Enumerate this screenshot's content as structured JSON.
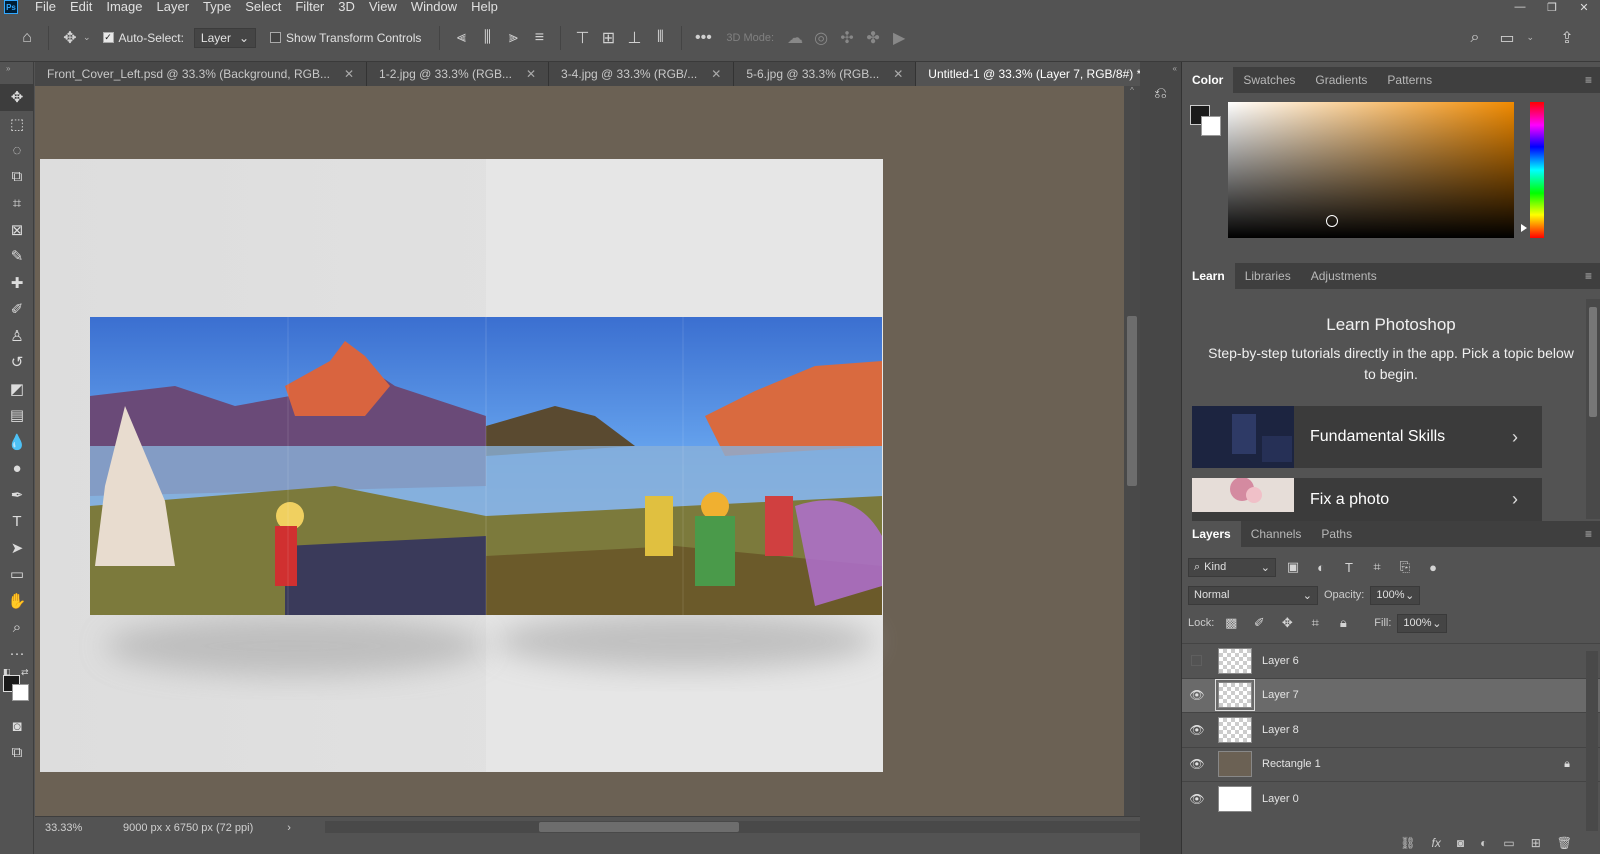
{
  "menubar": {
    "logo": "Ps",
    "items": [
      "File",
      "Edit",
      "Image",
      "Layer",
      "Type",
      "Select",
      "Filter",
      "3D",
      "View",
      "Window",
      "Help"
    ],
    "window_controls": [
      "—",
      "❐",
      "✕"
    ]
  },
  "options_bar": {
    "auto_select_label": "Auto-Select:",
    "auto_select_value": "Layer",
    "show_transform_label": "Show Transform Controls",
    "mode_3d_label": "3D Mode:"
  },
  "tabs": [
    {
      "label": "Front_Cover_Left.psd @ 33.3% (Background, RGB...",
      "active": false
    },
    {
      "label": "1-2.jpg @ 33.3% (RGB...",
      "active": false
    },
    {
      "label": "3-4.jpg @ 33.3% (RGB/...",
      "active": false
    },
    {
      "label": "5-6.jpg @ 33.3% (RGB...",
      "active": false
    },
    {
      "label": "Untitled-1 @ 33.3% (Layer 7, RGB/8#) *",
      "active": true
    }
  ],
  "status": {
    "zoom": "33.33%",
    "doc_info": "9000 px x 6750 px (72 ppi)"
  },
  "color_panel": {
    "tabs": [
      "Color",
      "Swatches",
      "Gradients",
      "Patterns"
    ],
    "colors": {
      "foreground": "#1a1a1a",
      "background": "#ffffff",
      "hue": "#f08a00"
    }
  },
  "learn_panel": {
    "tabs": [
      "Learn",
      "Libraries",
      "Adjustments"
    ],
    "title": "Learn Photoshop",
    "subtitle": "Step-by-step tutorials directly in the app. Pick a topic below to begin.",
    "cards": [
      {
        "label": "Fundamental Skills"
      },
      {
        "label": "Fix a photo"
      }
    ]
  },
  "layers_panel": {
    "tabs": [
      "Layers",
      "Channels",
      "Paths"
    ],
    "filter_kind": "Kind",
    "blend_mode": "Normal",
    "opacity_label": "Opacity:",
    "opacity_value": "100%",
    "lock_label": "Lock:",
    "fill_label": "Fill:",
    "fill_value": "100%",
    "layers": [
      {
        "name": "Layer 6",
        "visible": false,
        "selected": false
      },
      {
        "name": "Layer 7",
        "visible": true,
        "selected": true
      },
      {
        "name": "Layer 8",
        "visible": true,
        "selected": false
      },
      {
        "name": "Rectangle 1",
        "visible": true,
        "selected": false,
        "locked": true
      },
      {
        "name": "Layer 0",
        "visible": true,
        "selected": false
      }
    ],
    "footer_icons": [
      "link-icon",
      "fx-icon",
      "mask-icon",
      "adjustment-icon",
      "group-icon",
      "new-layer-icon",
      "trash-icon"
    ]
  },
  "canvas": {
    "background_color": "#6b6154",
    "document_color": "#dedede"
  }
}
